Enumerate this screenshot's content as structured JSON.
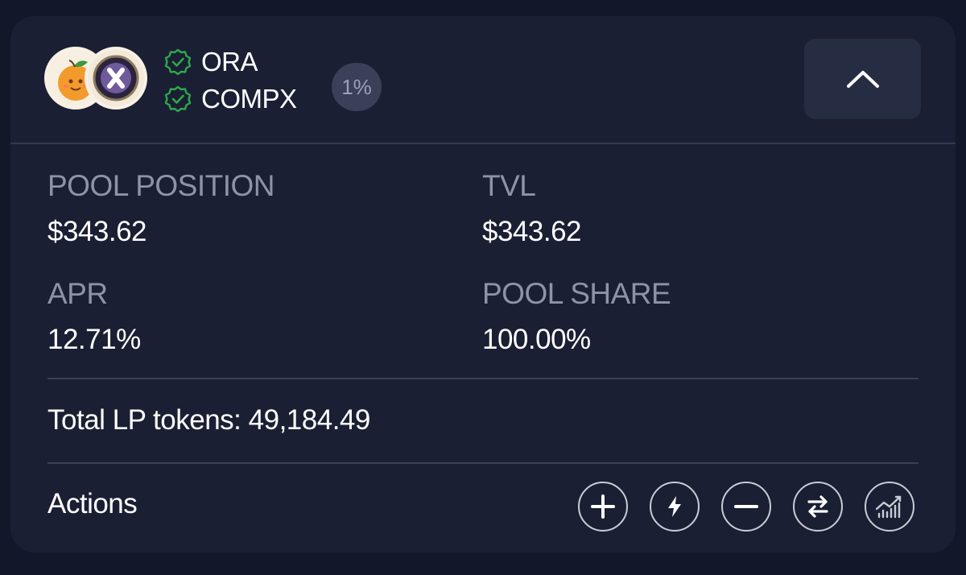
{
  "pool": {
    "tokens": [
      {
        "symbol": "ORA",
        "icon": "ora-orange-logo",
        "verified_icon": "verified-badge-icon"
      },
      {
        "symbol": "COMPX",
        "icon": "compx-x-logo",
        "verified_icon": "verified-badge-icon"
      }
    ],
    "fee_badge": "1%",
    "collapse_icon": "chevron-up-icon"
  },
  "stats": {
    "pool_position": {
      "label": "POOL POSITION",
      "value": "$343.62"
    },
    "tvl": {
      "label": "TVL",
      "value": "$343.62"
    },
    "apr": {
      "label": "APR",
      "value": "12.71%"
    },
    "pool_share": {
      "label": "POOL SHARE",
      "value": "100.00%"
    }
  },
  "lp": {
    "label": "Total LP tokens:",
    "value": "49,184.49"
  },
  "actions": {
    "label": "Actions",
    "buttons": [
      {
        "name": "add",
        "icon": "plus-icon"
      },
      {
        "name": "zap",
        "icon": "lightning-icon"
      },
      {
        "name": "remove",
        "icon": "minus-icon"
      },
      {
        "name": "swap",
        "icon": "swap-arrows-icon"
      },
      {
        "name": "analytics",
        "icon": "chart-icon"
      }
    ]
  },
  "colors": {
    "background": "#12172a",
    "card": "#1a1f33",
    "verified": "#2ea84a",
    "muted_text": "#8e93a6",
    "badge_bg": "#3a4057"
  }
}
